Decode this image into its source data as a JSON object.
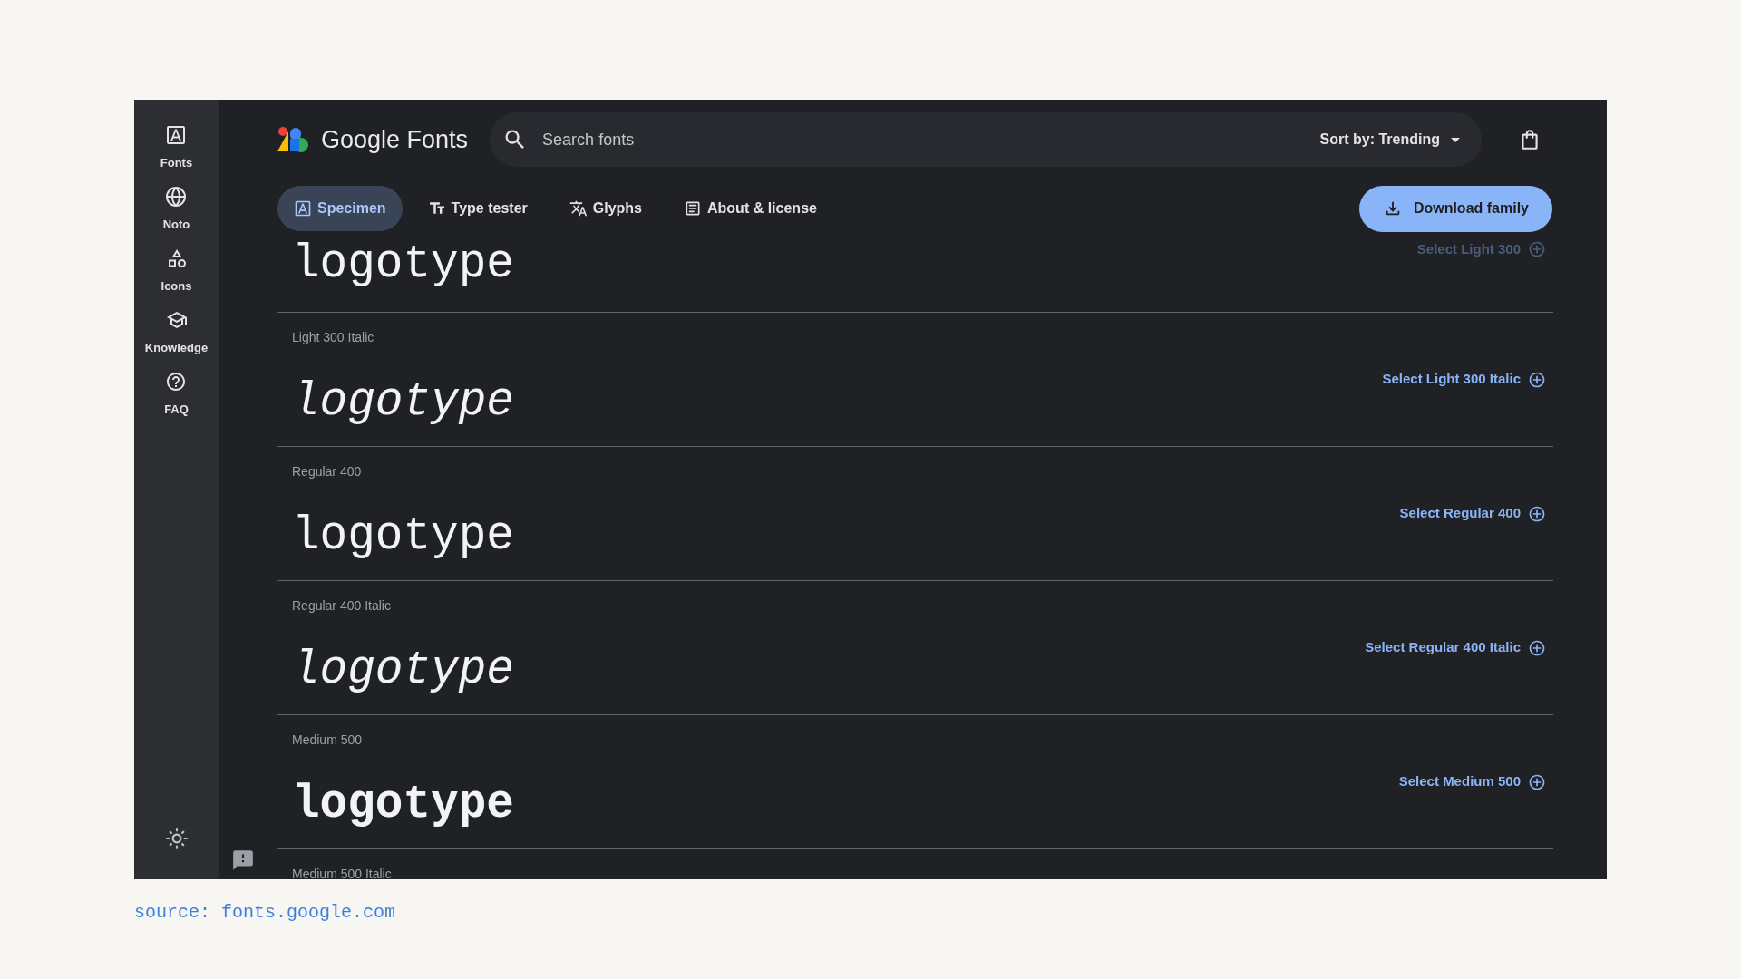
{
  "sidebar": {
    "items": [
      {
        "kind": "fonts",
        "label": "Fonts"
      },
      {
        "kind": "globe",
        "label": "Noto"
      },
      {
        "kind": "shapes",
        "label": "Icons"
      },
      {
        "kind": "school",
        "label": "Knowledge"
      },
      {
        "kind": "help",
        "label": "FAQ"
      }
    ]
  },
  "header": {
    "logo_text": "Google Fonts",
    "search": {
      "placeholder": "Search fonts"
    },
    "sort": "Sort by: Trending"
  },
  "tabs": [
    {
      "kind": "specimen",
      "label": "Specimen",
      "selected": true
    },
    {
      "kind": "tester",
      "label": "Type tester",
      "selected": false
    },
    {
      "kind": "glyphs",
      "label": "Glyphs",
      "selected": false
    },
    {
      "kind": "about",
      "label": "About & license",
      "selected": false
    }
  ],
  "download_button": "Download family",
  "styles": [
    {
      "kind": "light",
      "sample": "logotype",
      "select": "Select Light 300"
    },
    {
      "kind": "light-italic",
      "label": "Light 300 Italic",
      "sample": "logotype",
      "select": "Select Light 300 Italic"
    },
    {
      "kind": "regular",
      "label": "Regular 400",
      "sample": "logotype",
      "select": "Select Regular 400"
    },
    {
      "kind": "regular-italic",
      "label": "Regular 400 Italic",
      "sample": "logotype",
      "select": "Select Regular 400 Italic"
    },
    {
      "kind": "medium",
      "label": "Medium 500",
      "sample": "logotype",
      "select": "Select Medium 500"
    },
    {
      "kind": "medium-italic",
      "label": "Medium 500 Italic"
    }
  ],
  "caption": "source: fonts.google.com"
}
